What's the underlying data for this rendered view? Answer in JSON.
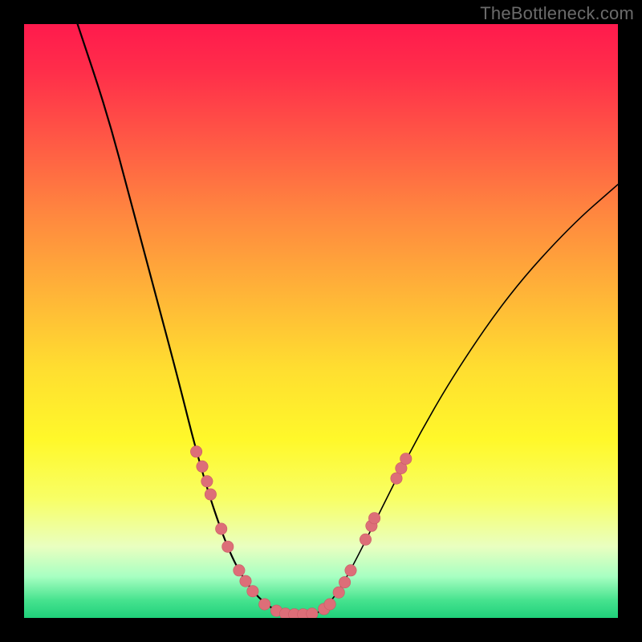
{
  "watermark": "TheBottleneck.com",
  "colors": {
    "frame": "#000000",
    "gradient_top": "#ff1a4d",
    "gradient_bottom": "#1fd07a",
    "curve": "#000000",
    "dot_fill": "#dd6e78",
    "dot_stroke": "#c85a64"
  },
  "chart_data": {
    "type": "line",
    "title": "",
    "xlabel": "",
    "ylabel": "",
    "xlim": [
      0,
      100
    ],
    "ylim": [
      0,
      100
    ],
    "grid": false,
    "notes": "Two V-shaped bottleneck curves on a vertical heat gradient; lower y = better (green). Values are percent of plot area, estimated from pixels.",
    "series": [
      {
        "name": "curve-left-steep",
        "type": "line",
        "points": [
          {
            "x": 9,
            "y": 100
          },
          {
            "x": 14,
            "y": 85
          },
          {
            "x": 18,
            "y": 70
          },
          {
            "x": 22,
            "y": 55
          },
          {
            "x": 26,
            "y": 40
          },
          {
            "x": 29,
            "y": 28
          },
          {
            "x": 32,
            "y": 18
          },
          {
            "x": 35,
            "y": 10
          },
          {
            "x": 38,
            "y": 5
          },
          {
            "x": 41,
            "y": 2
          },
          {
            "x": 44,
            "y": 0.5
          }
        ]
      },
      {
        "name": "curve-right-shallow",
        "type": "line",
        "points": [
          {
            "x": 49,
            "y": 0.5
          },
          {
            "x": 52,
            "y": 3
          },
          {
            "x": 55,
            "y": 8
          },
          {
            "x": 60,
            "y": 18
          },
          {
            "x": 66,
            "y": 30
          },
          {
            "x": 73,
            "y": 42
          },
          {
            "x": 82,
            "y": 55
          },
          {
            "x": 92,
            "y": 66
          },
          {
            "x": 100,
            "y": 73
          }
        ]
      },
      {
        "name": "dots",
        "type": "scatter",
        "points": [
          {
            "x": 29.0,
            "y": 28.0
          },
          {
            "x": 30.0,
            "y": 25.5
          },
          {
            "x": 30.8,
            "y": 23.0
          },
          {
            "x": 31.4,
            "y": 20.8
          },
          {
            "x": 33.2,
            "y": 15.0
          },
          {
            "x": 34.3,
            "y": 12.0
          },
          {
            "x": 36.2,
            "y": 8.0
          },
          {
            "x": 37.3,
            "y": 6.2
          },
          {
            "x": 38.5,
            "y": 4.5
          },
          {
            "x": 40.5,
            "y": 2.3
          },
          {
            "x": 42.5,
            "y": 1.2
          },
          {
            "x": 44.0,
            "y": 0.7
          },
          {
            "x": 45.5,
            "y": 0.6
          },
          {
            "x": 47.0,
            "y": 0.6
          },
          {
            "x": 48.5,
            "y": 0.7
          },
          {
            "x": 50.5,
            "y": 1.5
          },
          {
            "x": 51.5,
            "y": 2.3
          },
          {
            "x": 53.0,
            "y": 4.3
          },
          {
            "x": 54.0,
            "y": 6.0
          },
          {
            "x": 55.0,
            "y": 8.0
          },
          {
            "x": 57.5,
            "y": 13.2
          },
          {
            "x": 58.5,
            "y": 15.5
          },
          {
            "x": 59.0,
            "y": 16.8
          },
          {
            "x": 62.7,
            "y": 23.5
          },
          {
            "x": 63.5,
            "y": 25.2
          },
          {
            "x": 64.3,
            "y": 26.8
          }
        ]
      }
    ]
  }
}
